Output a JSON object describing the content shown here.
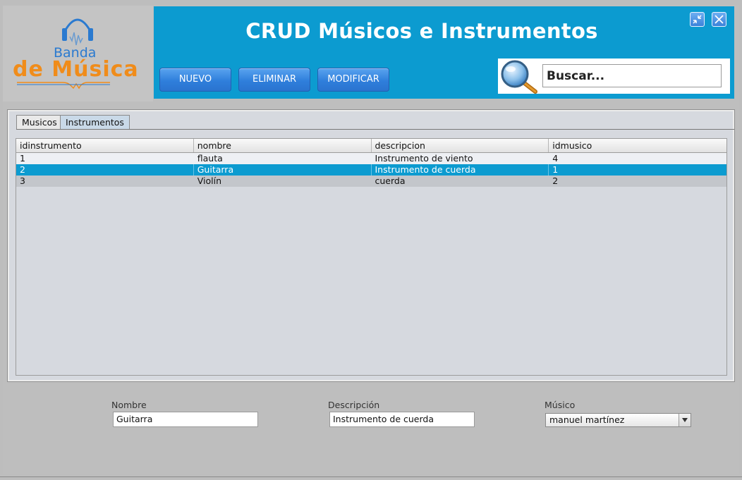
{
  "logo": {
    "line1": "Banda",
    "line2": "de Música"
  },
  "header": {
    "title": "CRUD Músicos e Instrumentos"
  },
  "window_controls": {
    "minimize_icon": "shrink-icon",
    "close_icon": "close-icon"
  },
  "toolbar": {
    "new_label": "NUEVO",
    "delete_label": "ELIMINAR",
    "edit_label": "MODIFICAR"
  },
  "search": {
    "placeholder": "Buscar...",
    "icon": "magnifier-icon"
  },
  "tabs": [
    {
      "label": "Musicos",
      "active": false
    },
    {
      "label": "Instrumentos",
      "active": true
    }
  ],
  "table": {
    "columns": [
      "idinstrumento",
      "nombre",
      "descripcion",
      "idmusico"
    ],
    "rows": [
      [
        "1",
        "flauta",
        "Instrumento de viento",
        "4"
      ],
      [
        "2",
        "Guitarra",
        "Instrumento de cuerda",
        "1"
      ],
      [
        "3",
        "Violín",
        "cuerda",
        "2"
      ]
    ],
    "selected_row": 1
  },
  "form": {
    "nombre_label": "Nombre",
    "nombre_value": "Guitarra",
    "descripcion_label": "Descripción",
    "descripcion_value": "Instrumento de cuerda",
    "musico_label": "Músico",
    "musico_value": "manuel martínez"
  },
  "colors": {
    "accent": "#0c9bd0",
    "button": "#2f7fdc",
    "logo_orange": "#f08c1a",
    "logo_blue": "#2a7ad0"
  }
}
